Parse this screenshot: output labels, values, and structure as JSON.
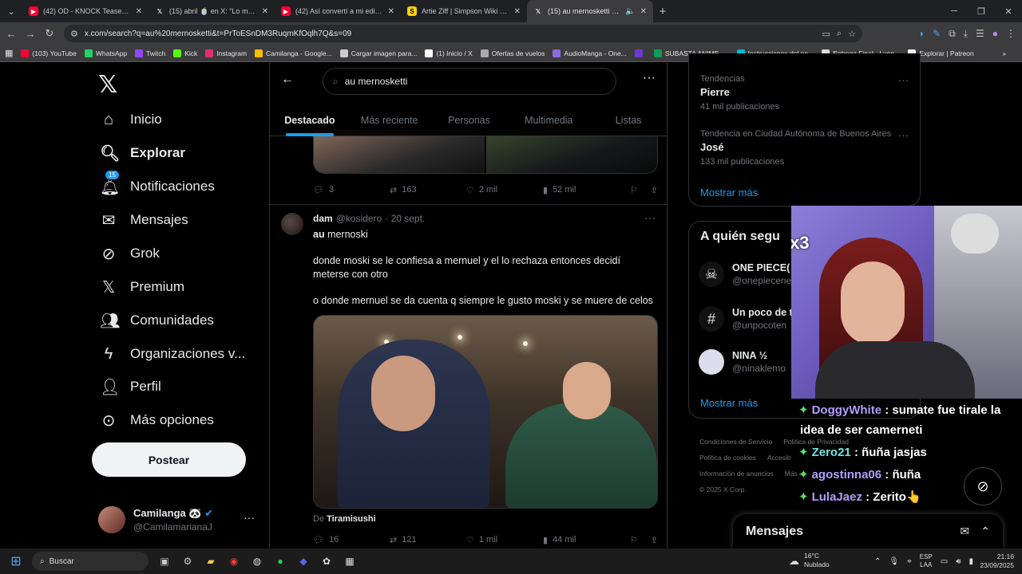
{
  "browser": {
    "tabs": [
      {
        "label": "(42) OD - KNOCK Teaser Trailer",
        "icon": "youtube-icon"
      },
      {
        "label": "(15) abril 🍵 en X: \"Lo más grac",
        "icon": "x-icon"
      },
      {
        "label": "(42) Así convertí a mi editor en",
        "icon": "youtube-icon"
      },
      {
        "label": "Artie Ziff | Simpson Wiki en Esp",
        "icon": "wiki-icon"
      },
      {
        "label": "(15) au mernosketti - Busca",
        "icon": "x-icon",
        "active": true
      }
    ],
    "url": "x.com/search?q=au%20mernosketti&t=PrToESnDM3RuqmKfOqlh7Q&s=09",
    "bookmarks": [
      {
        "label": "(103) YouTube",
        "color": "#ff0033"
      },
      {
        "label": "WhatsApp",
        "color": "#25d366"
      },
      {
        "label": "Twitch",
        "color": "#9146ff"
      },
      {
        "label": "Kick",
        "color": "#53fc18"
      },
      {
        "label": "Instagram",
        "color": "#e1306c"
      },
      {
        "label": "Camilanga - Google...",
        "color": "#fbbc04"
      },
      {
        "label": "Cargar imagen para...",
        "color": "#cccccc"
      },
      {
        "label": "(1) Inicio / X",
        "color": "#ffffff"
      },
      {
        "label": "Ofertas de vuelos",
        "color": "#aaaaaa"
      },
      {
        "label": "AudioManga - One...",
        "color": "#8a6bdc"
      },
      {
        "label": "",
        "color": "#6a3ad0"
      },
      {
        "label": "SUBASTA ANIME -...",
        "color": "#0f9d58"
      },
      {
        "label": "Instrucciones del pe...",
        "color": "#00bcd4"
      },
      {
        "label": "Entrega Final - Luon...",
        "color": "#dddddd"
      },
      {
        "label": "Explorar | Patreon",
        "color": "#ffffff"
      }
    ]
  },
  "nav": {
    "items": [
      {
        "label": "Inicio",
        "icon": "home-icon"
      },
      {
        "label": "Explorar",
        "icon": "search-icon"
      },
      {
        "label": "Notificaciones",
        "icon": "bell-icon",
        "badge": "15"
      },
      {
        "label": "Mensajes",
        "icon": "mail-icon"
      },
      {
        "label": "Grok",
        "icon": "grok-icon"
      },
      {
        "label": "Premium",
        "icon": "x-icon"
      },
      {
        "label": "Comunidades",
        "icon": "people-icon"
      },
      {
        "label": "Organizaciones v...",
        "icon": "lightning-icon"
      },
      {
        "label": "Perfil",
        "icon": "person-icon"
      },
      {
        "label": "Más opciones",
        "icon": "more-circle-icon"
      }
    ],
    "post_label": "Postear",
    "account": {
      "name": "Camilanga 🐼",
      "handle": "@CamilamarianaJ"
    }
  },
  "search": {
    "query": "au mernosketti",
    "tabs": [
      "Destacado",
      "Más reciente",
      "Personas",
      "Multimedia",
      "Listas"
    ]
  },
  "prev_tweet": {
    "replies": "3",
    "reposts": "163",
    "likes": "2 mil",
    "views": "52 mil"
  },
  "tweet": {
    "name": "dam",
    "handle": "@kosidero",
    "date": "· 20 sept.",
    "line1_bold": "au",
    "line1_rest": " mernoski",
    "para1": "donde moski se le confiesa a mernuel y el lo rechaza entonces decidí meterse con otro",
    "para2": "o donde mernuel se da cuenta q siempre le gusto moski y se muere de celos",
    "from_label": "De",
    "from_source": "Tiramisushi",
    "replies": "16",
    "reposts": "121",
    "likes": "1 mil",
    "views": "44 mil"
  },
  "trends": [
    {
      "context": "Tendencias",
      "name": "Pierre",
      "posts": "41 mil publicaciones"
    },
    {
      "context": "Tendencia en Ciudad Autónoma de Buenos Aires",
      "name": "José",
      "posts": "133 mil publicaciones"
    }
  ],
  "show_more": "Mostrar más",
  "follow": {
    "title": "A quién segu",
    "items": [
      {
        "name": "ONE PIECE(",
        "handle": "@onepiecene",
        "icon": "skull-icon"
      },
      {
        "name": "Un poco de t",
        "handle": "@unpocoten",
        "icon": "hash-icon"
      },
      {
        "name": "NINA ½",
        "handle": "@ninaklemo",
        "icon": "avatar-icon"
      }
    ]
  },
  "footer": [
    "Condiciones de Servicio",
    "Política de Privacidad",
    "Política de cookies",
    "Accesib",
    "Información de anuncios",
    "Más op",
    "© 2025 X Corp."
  ],
  "stream": {
    "overlay_badge": "x3",
    "chat": [
      {
        "user": "DoggyWhite",
        "text": " : sumate fue tirale la",
        "text2": "idea de ser camerneti"
      },
      {
        "user": "Zero21",
        "text": " : ñuña jasjas"
      },
      {
        "user": "agostinna06",
        "text": " : ñuña"
      },
      {
        "user": "LulaJaez",
        "text": " : Zerito👆"
      }
    ]
  },
  "messages_label": "Mensajes",
  "taskbar": {
    "search": "Buscar",
    "weather_temp": "16°C",
    "weather_desc": "Nublado",
    "lang1": "ESP",
    "lang2": "LAA",
    "time": "21:16",
    "date": "23/09/2025"
  }
}
